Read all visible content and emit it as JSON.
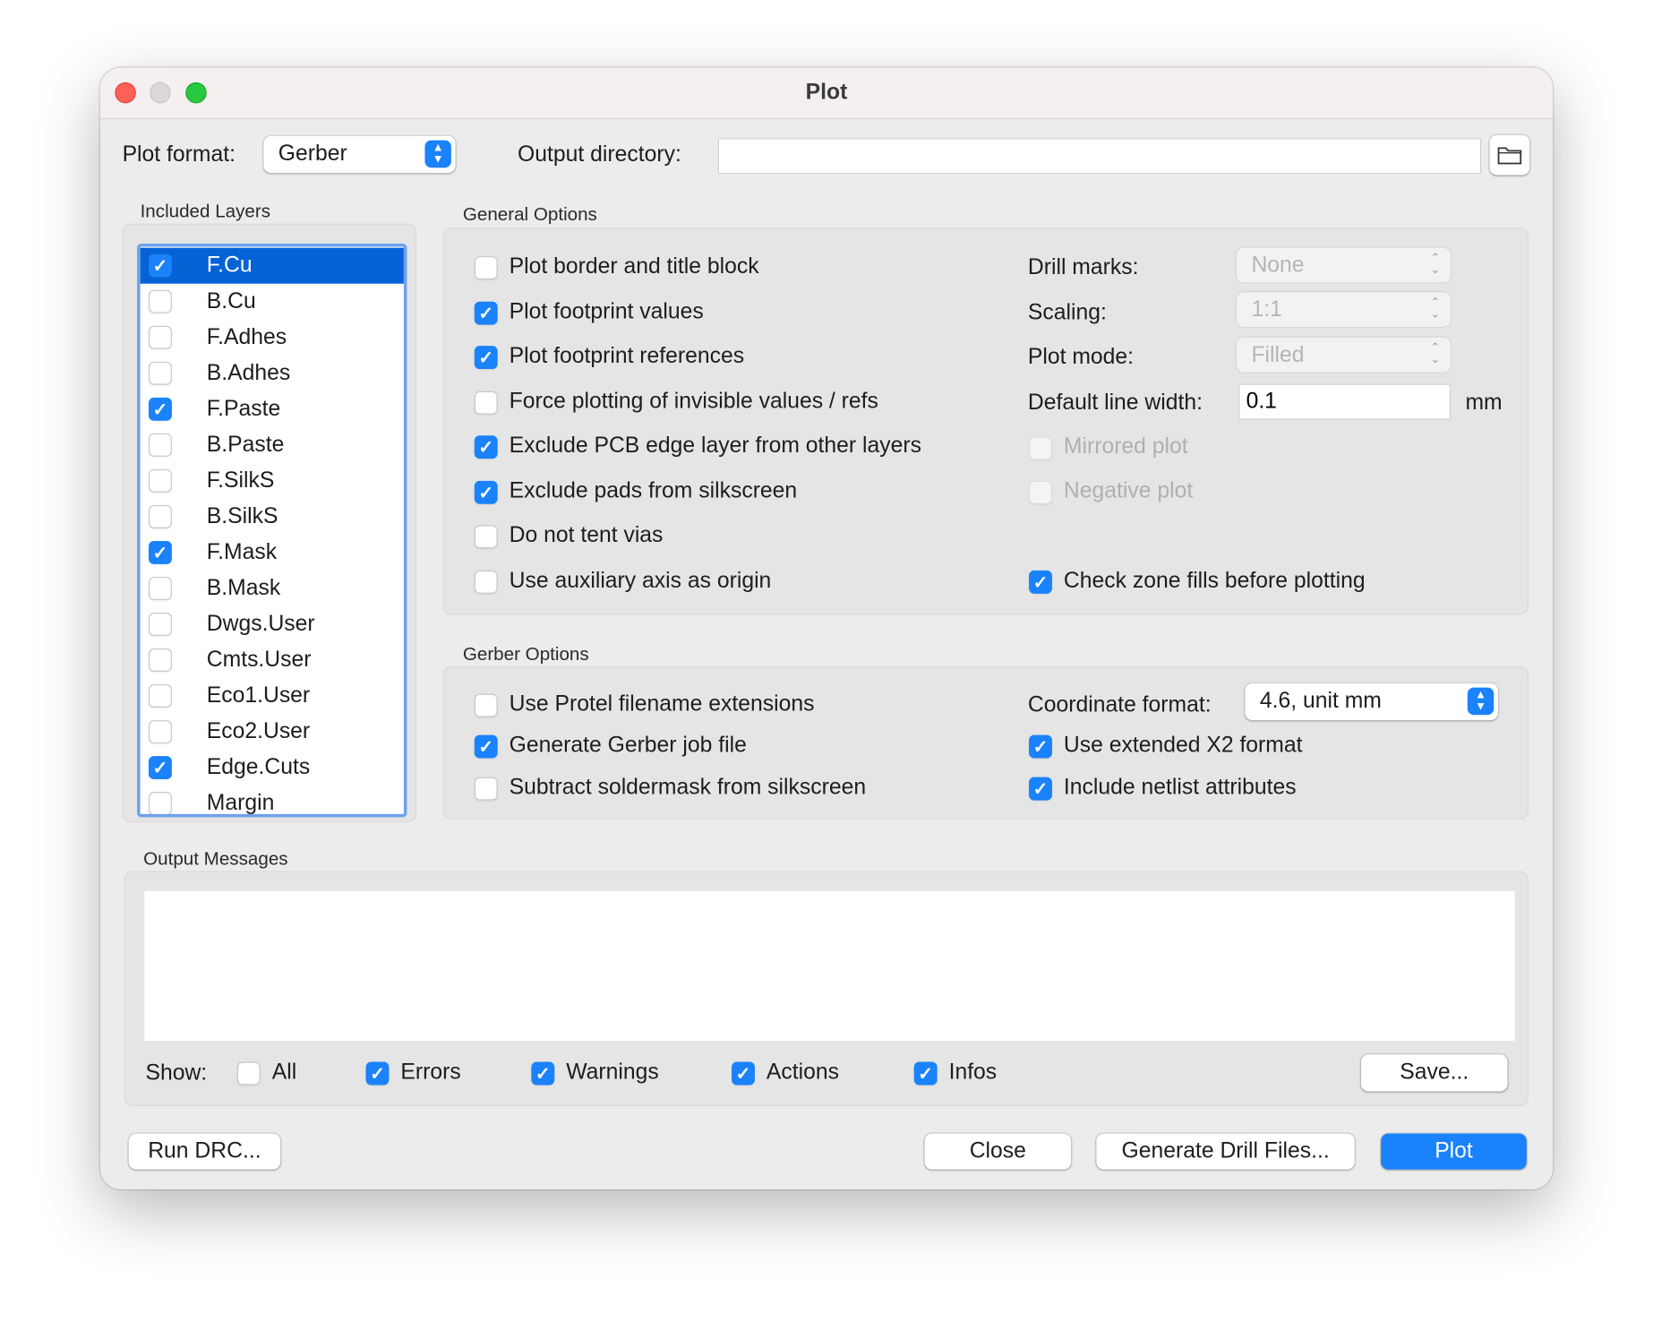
{
  "window": {
    "title": "Plot"
  },
  "top": {
    "plot_format_label": "Plot format:",
    "plot_format_value": "Gerber",
    "output_dir_label": "Output directory:",
    "output_dir_value": ""
  },
  "layers": {
    "label": "Included Layers",
    "items": [
      {
        "name": "F.Cu",
        "checked": true,
        "selected": true
      },
      {
        "name": "B.Cu",
        "checked": false
      },
      {
        "name": "F.Adhes",
        "checked": false
      },
      {
        "name": "B.Adhes",
        "checked": false
      },
      {
        "name": "F.Paste",
        "checked": true
      },
      {
        "name": "B.Paste",
        "checked": false
      },
      {
        "name": "F.SilkS",
        "checked": false
      },
      {
        "name": "B.SilkS",
        "checked": false
      },
      {
        "name": "F.Mask",
        "checked": true
      },
      {
        "name": "B.Mask",
        "checked": false
      },
      {
        "name": "Dwgs.User",
        "checked": false
      },
      {
        "name": "Cmts.User",
        "checked": false
      },
      {
        "name": "Eco1.User",
        "checked": false
      },
      {
        "name": "Eco2.User",
        "checked": false
      },
      {
        "name": "Edge.Cuts",
        "checked": true
      },
      {
        "name": "Margin",
        "checked": false
      }
    ]
  },
  "general": {
    "label": "General Options",
    "options": [
      {
        "label": "Plot border and title block",
        "checked": false
      },
      {
        "label": "Plot footprint values",
        "checked": true
      },
      {
        "label": "Plot footprint references",
        "checked": true
      },
      {
        "label": "Force plotting of invisible values / refs",
        "checked": false
      },
      {
        "label": "Exclude PCB edge layer from other layers",
        "checked": true
      },
      {
        "label": "Exclude pads from silkscreen",
        "checked": true
      },
      {
        "label": "Do not tent vias",
        "checked": false
      },
      {
        "label": "Use auxiliary axis as origin",
        "checked": false
      }
    ],
    "drill_marks_label": "Drill marks:",
    "drill_marks_value": "None",
    "scaling_label": "Scaling:",
    "scaling_value": "1:1",
    "plot_mode_label": "Plot mode:",
    "plot_mode_value": "Filled",
    "line_width_label": "Default line width:",
    "line_width_value": "0.1",
    "line_width_unit": "mm",
    "mirrored_label": "Mirrored plot",
    "negative_label": "Negative plot",
    "check_zone_label": "Check zone fills before plotting"
  },
  "gerber": {
    "label": "Gerber Options",
    "options": [
      {
        "label": "Use Protel filename extensions",
        "checked": false
      },
      {
        "label": "Generate Gerber job file",
        "checked": true
      },
      {
        "label": "Subtract soldermask from silkscreen",
        "checked": false
      }
    ],
    "coord_label": "Coordinate format:",
    "coord_value": "4.6, unit mm",
    "x2_label": "Use extended X2 format",
    "netlist_label": "Include netlist attributes"
  },
  "messages": {
    "label": "Output Messages",
    "text": "",
    "show_label": "Show:",
    "filters": [
      {
        "label": "All",
        "checked": false
      },
      {
        "label": "Errors",
        "checked": true
      },
      {
        "label": "Warnings",
        "checked": true
      },
      {
        "label": "Actions",
        "checked": true
      },
      {
        "label": "Infos",
        "checked": true
      }
    ],
    "save_label": "Save..."
  },
  "buttons": {
    "run_drc": "Run DRC...",
    "close": "Close",
    "drill": "Generate Drill Files...",
    "plot": "Plot"
  },
  "colors": {
    "accent": "#1a82fb",
    "selection": "#0563d6"
  }
}
